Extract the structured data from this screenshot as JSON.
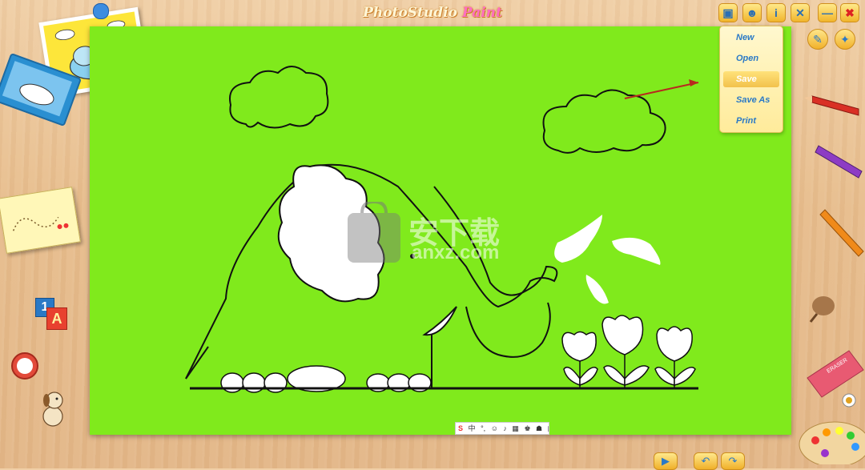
{
  "app": {
    "title_part1": "PhotoStudio ",
    "title_part2": "Paint"
  },
  "toolbar": {
    "buttons": [
      {
        "name": "edit-button",
        "icon": "notebook-icon",
        "glyph": "▣"
      },
      {
        "name": "users-button",
        "icon": "people-icon",
        "glyph": "☻"
      },
      {
        "name": "info-button",
        "icon": "info-icon",
        "glyph": "i"
      },
      {
        "name": "settings-button",
        "icon": "tools-icon",
        "glyph": "✕"
      },
      {
        "name": "minimize-button",
        "icon": "minimize-icon",
        "glyph": "—"
      },
      {
        "name": "close-button",
        "icon": "close-icon",
        "glyph": "✖"
      }
    ]
  },
  "file_menu": {
    "items": [
      {
        "label": "New",
        "selected": false
      },
      {
        "label": "Open",
        "selected": false
      },
      {
        "label": "Save",
        "selected": true
      },
      {
        "label": "Save As",
        "selected": false
      },
      {
        "label": "Print",
        "selected": false
      }
    ]
  },
  "side_tools": [
    {
      "name": "pencil-tool",
      "icon": "pencil-icon"
    },
    {
      "name": "magic-wand-tool",
      "icon": "magic-wand-icon"
    }
  ],
  "right_tray": [
    {
      "name": "red-pencil",
      "icon": "pencil-icon",
      "color": "#d93025"
    },
    {
      "name": "purple-marker",
      "icon": "marker-icon",
      "color": "#8d3cc4"
    },
    {
      "name": "orange-crayon",
      "icon": "crayon-icon",
      "color": "#f08a1a"
    },
    {
      "name": "paint-brush",
      "icon": "brush-icon",
      "color": "#8a5a2b"
    },
    {
      "name": "eraser",
      "icon": "eraser-icon",
      "color": "#e85a72",
      "label": "ERASER"
    },
    {
      "name": "color-wheel",
      "icon": "color-wheel-icon",
      "color": "#ffffff"
    },
    {
      "name": "paint-palette",
      "icon": "palette-icon",
      "color": "#f2d6a0"
    }
  ],
  "left_tray": [
    {
      "name": "elephant-picture",
      "icon": "elephant-picture-icon"
    },
    {
      "name": "whale-book",
      "icon": "whale-book-icon"
    },
    {
      "name": "dot-to-dot-book",
      "icon": "dot-book-icon"
    },
    {
      "name": "abc-blocks",
      "icon": "blocks-icon",
      "letters": "1A"
    },
    {
      "name": "alarm-clock",
      "icon": "clock-icon"
    },
    {
      "name": "dog-toy",
      "icon": "dog-icon"
    }
  ],
  "canvas": {
    "background": "#80ea1c",
    "watermark_text": "安下载",
    "watermark_sub": "anxz.com"
  },
  "statusbar": {
    "items": [
      "S",
      "中",
      "°,",
      "☺",
      "♪",
      "▦",
      "♚",
      "☗",
      "▦"
    ]
  },
  "bottom_controls": [
    {
      "name": "play-button",
      "icon": "play-icon",
      "glyph": "▶"
    },
    {
      "name": "undo-button",
      "icon": "undo-icon",
      "glyph": "↶"
    },
    {
      "name": "redo-button",
      "icon": "redo-icon",
      "glyph": "↷"
    }
  ],
  "colors": {
    "accent_blue": "#2a79c6",
    "button_gold": "#f1b52c",
    "desk_wood": "#e7bd8d"
  }
}
